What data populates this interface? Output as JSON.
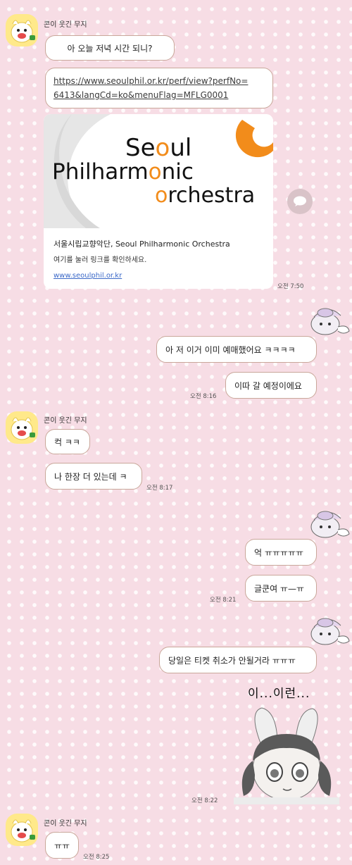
{
  "sender_name": "콘이 웃긴 무지",
  "messages": {
    "m1": "아 오늘 저녁 시간 되니?",
    "link_line1": "https://www.seoulphil.or.kr/perf/view?perfNo=",
    "link_line2": "6413&langCd=ko&menuFlag=MFLG0001",
    "card": {
      "logo_line1": "Seoul",
      "logo_line2": "Philharmonic",
      "logo_line3": "orchestra",
      "title": "서울시립교향악단, Seoul Philharmonic Orchestra",
      "description": "여기를 눌러 링크를 확인하세요.",
      "url": "www.seoulphil.or.kr"
    },
    "t1": "오전 7:50",
    "m2": "아 저 이거 이미 예매했어요 ㅋㅋㅋㅋ",
    "m3": "이따 갈 예정이에요",
    "t2": "오전 8:16",
    "m4": "컥 ㅋㅋ",
    "m5": "나 한장 더 있는데 ㅋ",
    "t3": "오전 8:17",
    "m6": "억 ㅠㅠㅠㅠㅠ",
    "m7": "글쿤여 ㅠ—ㅠ",
    "t4": "오전 8:21",
    "m8": "당일은 티켓 취소가 안될거라 ㅠㅠㅠ",
    "sticker_text": "이...이런...",
    "t5": "오전 8:22",
    "m9": "ㅠㅠ",
    "t6": "오전 8:25"
  },
  "icons": {
    "share": "share-icon",
    "avatar": "muzi-avatar",
    "my_sticker": "kuromi-sticker"
  },
  "colors": {
    "background": "#f7dde5",
    "bubble_border": "#c9a79a",
    "logo_accent": "#f28c1b",
    "link": "#3b69c8"
  }
}
